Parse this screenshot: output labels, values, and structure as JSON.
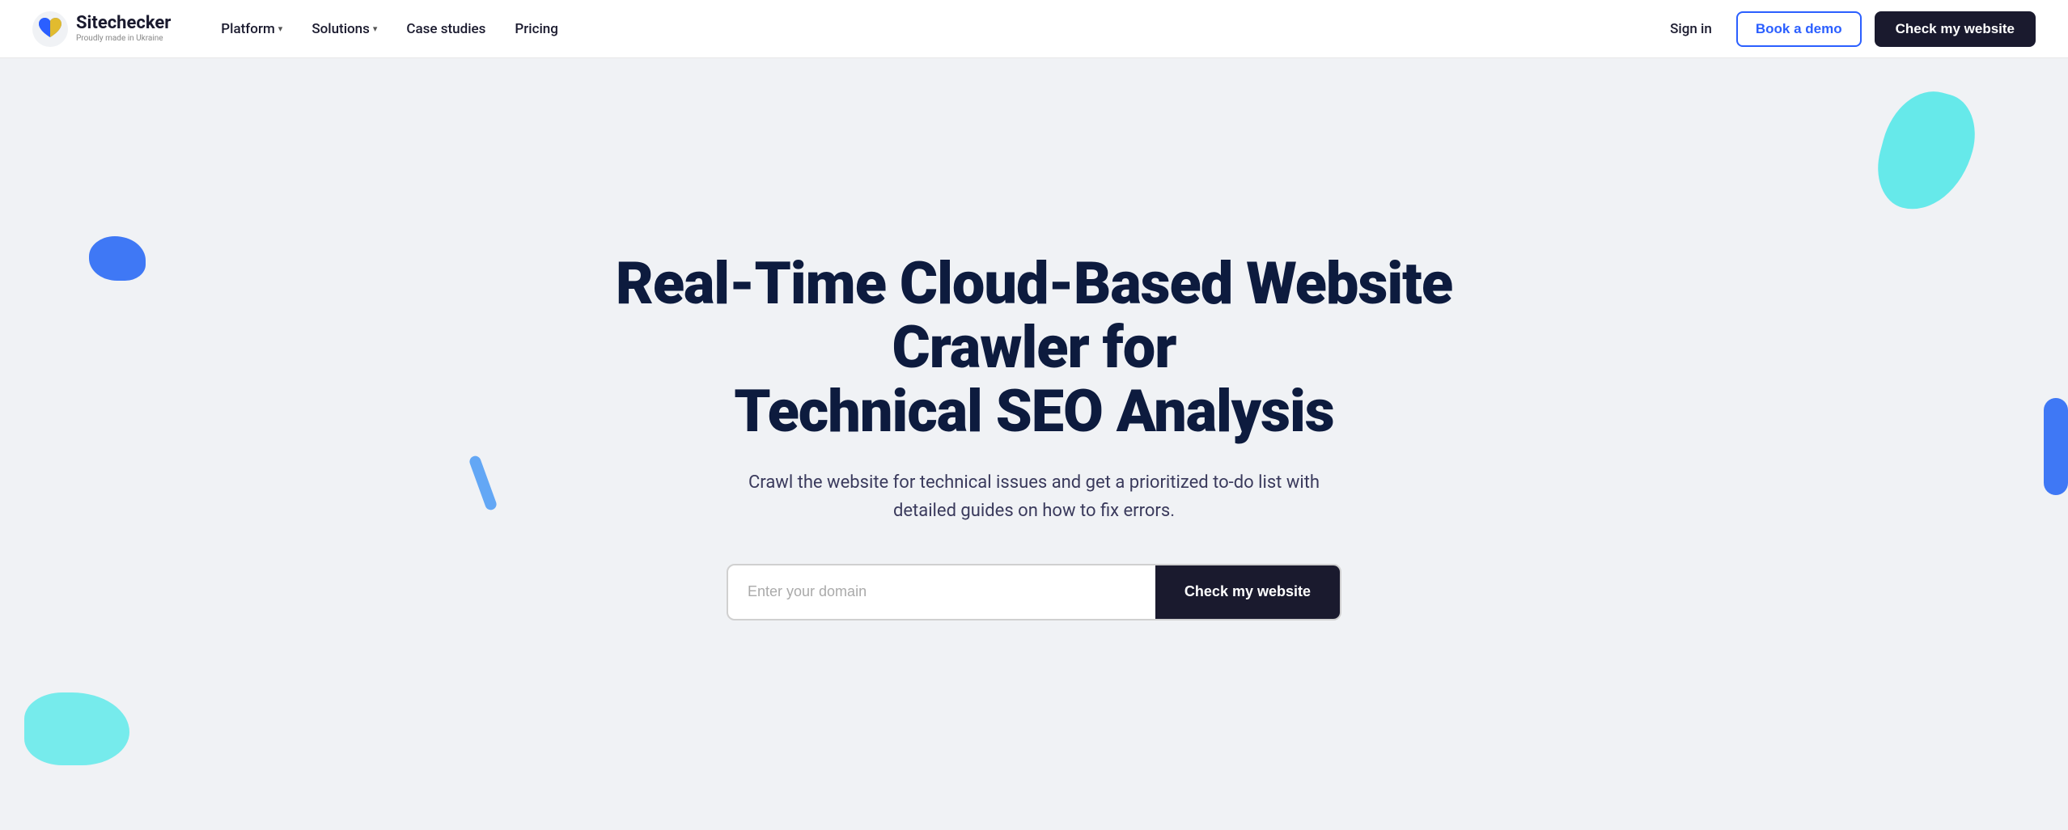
{
  "brand": {
    "name": "Sitechecker",
    "tagline": "Proudly made in Ukraine"
  },
  "navbar": {
    "platform_label": "Platform",
    "solutions_label": "Solutions",
    "case_studies_label": "Case studies",
    "pricing_label": "Pricing",
    "sign_in_label": "Sign in",
    "book_demo_label": "Book a demo",
    "check_website_label": "Check my website"
  },
  "hero": {
    "title_line1": "Real-Time Cloud-Based Website Crawler for",
    "title_line2": "Technical SEO Analysis",
    "subtitle": "Crawl the website for technical issues and get a prioritized to-do list with detailed guides on how to fix errors.",
    "input_placeholder": "Enter your domain",
    "cta_button": "Check my website"
  },
  "colors": {
    "dark_navy": "#0d1b3e",
    "brand_blue": "#2b5fff",
    "cyan": "#4ee8e8",
    "body_bg": "#f0f2f5"
  }
}
